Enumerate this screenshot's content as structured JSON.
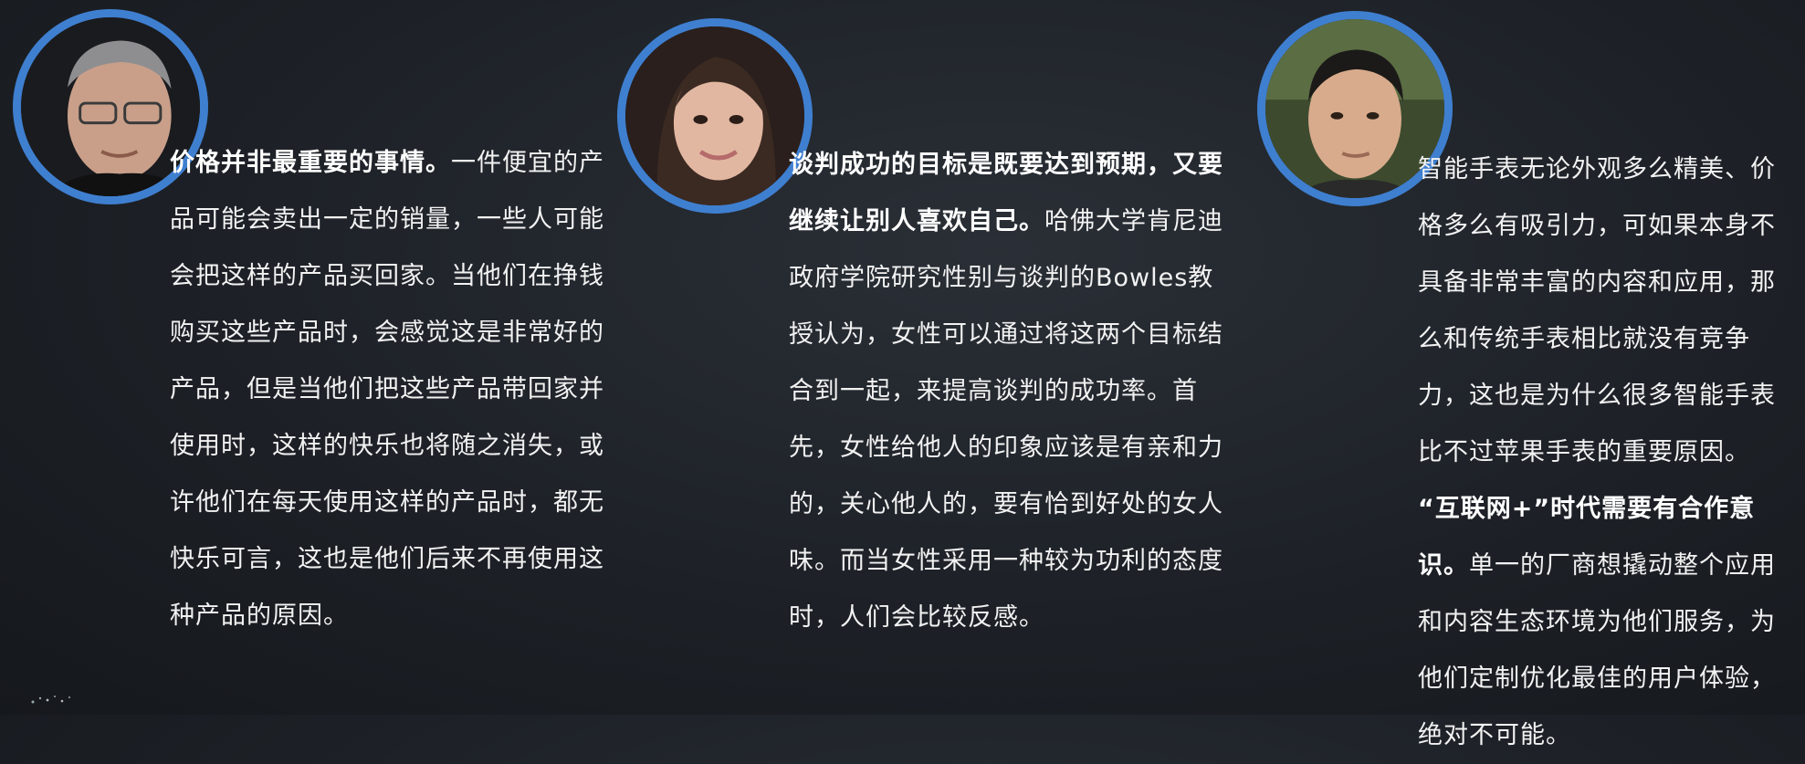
{
  "colors": {
    "background": "#1d2127",
    "ring": "#3f7fd0",
    "text": "#f2f2f2"
  },
  "speakers": [
    {
      "avatar_icon": "portrait-photo",
      "quote_bold": "价格并非最重要的事情。",
      "quote_text": "一件便宜的产品可能会卖出一定的销量，一些人可能会把这样的产品买回家。当他们在挣钱购买这些产品时，会感觉这是非常好的产品，但是当他们把这些产品带回家并使用时，这样的快乐也将随之消失，或许他们在每天使用这样的产品时，都无快乐可言，这也是他们后来不再使用这种产品的原因。"
    },
    {
      "avatar_icon": "portrait-photo",
      "quote_bold": "谈判成功的目标是既要达到预期，又要继续让别人喜欢自己。",
      "quote_text": "哈佛大学肯尼迪政府学院研究性别与谈判的Bowles教授认为，女性可以通过将这两个目标结合到一起，来提高谈判的成功率。首先，女性给他人的印象应该是有亲和力的，关心他人的，要有恰到好处的女人味。而当女性采用一种较为功利的态度时，人们会比较反感。"
    },
    {
      "avatar_icon": "portrait-photo",
      "quote_intro": "智能手表无论外观多么精美、价格多么有吸引力，可如果本身不具备非常丰富的内容和应用，那么和传统手表相比就没有竞争力，这也是为什么很多智能手表比不过苹果手表的重要原因。",
      "quote_bold": "“互联网+”时代需要有合作意识。",
      "quote_text": "单一的厂商想撬动整个应用和内容生态环境为他们服务，为他们定制优化最佳的用户体验，绝对不可能。"
    }
  ]
}
